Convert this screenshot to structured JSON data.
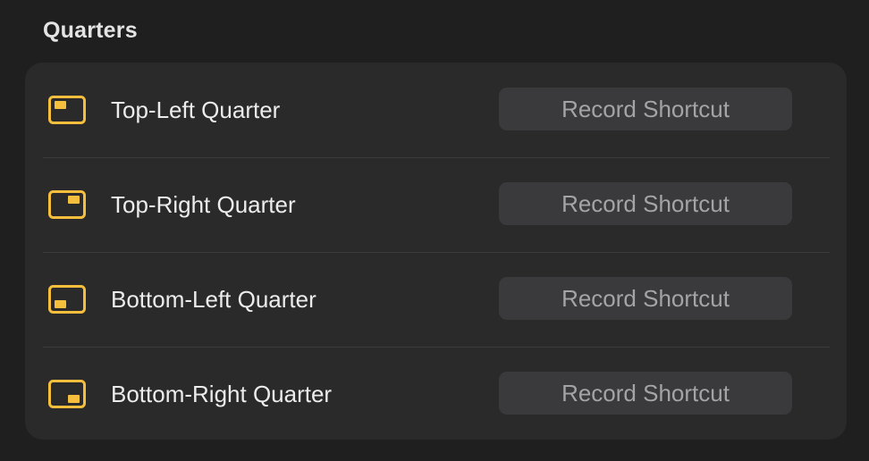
{
  "section": {
    "title": "Quarters"
  },
  "accent_color": "#f5be3d",
  "rows": [
    {
      "label": "Top-Left Quarter",
      "icon": "top-left-quarter-icon",
      "button_label": "Record Shortcut"
    },
    {
      "label": "Top-Right Quarter",
      "icon": "top-right-quarter-icon",
      "button_label": "Record Shortcut"
    },
    {
      "label": "Bottom-Left Quarter",
      "icon": "bottom-left-quarter-icon",
      "button_label": "Record Shortcut"
    },
    {
      "label": "Bottom-Right Quarter",
      "icon": "bottom-right-quarter-icon",
      "button_label": "Record Shortcut"
    }
  ]
}
